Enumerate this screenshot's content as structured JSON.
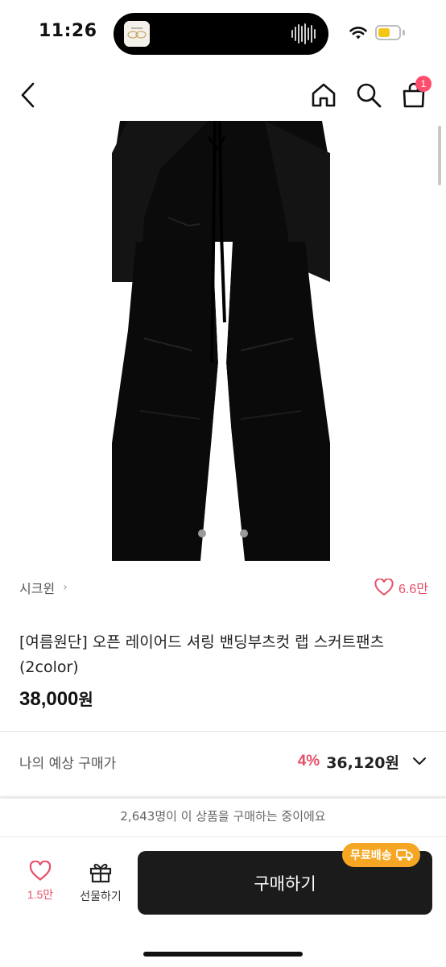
{
  "status_bar": {
    "time": "11:26",
    "battery_level": 0.6,
    "colors": {
      "battery": "#f5c518"
    }
  },
  "nav": {
    "icons": [
      "chevron-left-icon",
      "home-icon",
      "search-icon",
      "cart-icon"
    ],
    "cart_badge": "1"
  },
  "gallery": {
    "image_subject": "black wrap skirt pants",
    "page_count": 3,
    "active_index": 1
  },
  "store": {
    "name": "시크윈",
    "chevron": "›",
    "like_count": "6.6만"
  },
  "product": {
    "title": "[여름원단] 오픈 레이어드 셔링 밴딩부츠컷 랩 스커트팬츠 (2color)",
    "price_number": "38,000",
    "price_unit": "원"
  },
  "expected": {
    "label": "나의 예상 구매가",
    "rate": "4%",
    "price": "36,120원"
  },
  "bottom": {
    "buying_now": "2,643명이 이 상품을 구매하는 중이에요",
    "wish_count": "1.5만",
    "gift_label": "선물하기",
    "buy_label": "구매하기",
    "free_shipping": "무료배송"
  },
  "colors": {
    "accent_pink": "#e5506a",
    "badge": "#ff4d6d",
    "buy_button": "#1b1b1b",
    "free_shipping": "#f5a623"
  }
}
